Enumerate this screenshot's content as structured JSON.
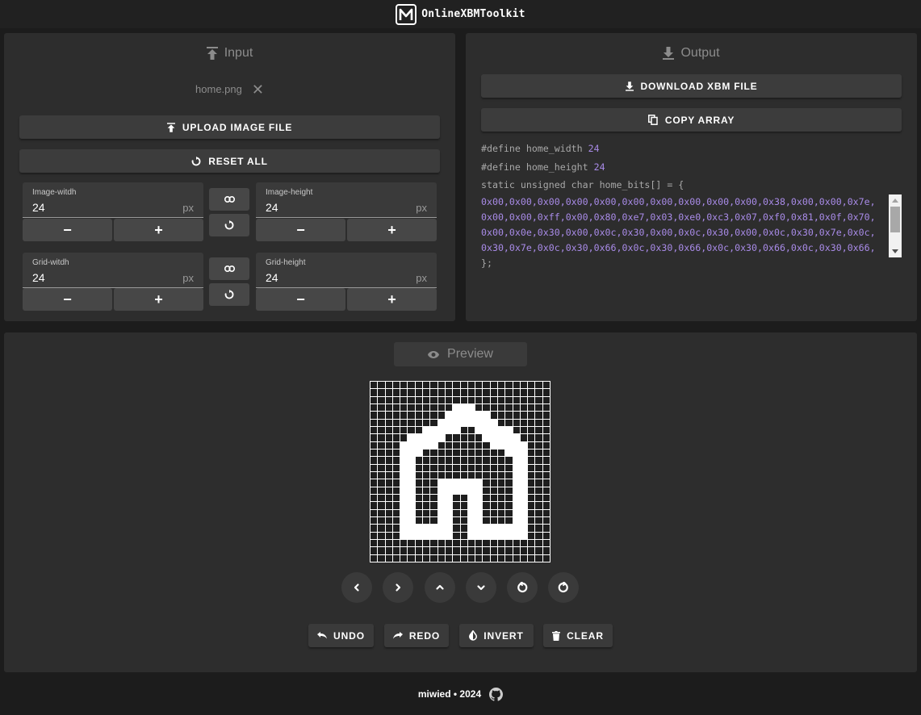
{
  "header": {
    "title": "OnlineXBMToolkit",
    "logo_icon": "logo-m-icon"
  },
  "input": {
    "title": "Input",
    "filename": "home.png",
    "upload_label": "UPLOAD IMAGE FILE",
    "reset_label": "RESET ALL",
    "image_width": {
      "label": "Image-witdh",
      "value": "24",
      "unit": "px"
    },
    "image_height": {
      "label": "Image-height",
      "value": "24",
      "unit": "px"
    },
    "grid_width": {
      "label": "Grid-witdh",
      "value": "24",
      "unit": "px"
    },
    "grid_height": {
      "label": "Grid-height",
      "value": "24",
      "unit": "px"
    },
    "minus": "−",
    "plus": "+"
  },
  "output": {
    "title": "Output",
    "download_label": "DOWNLOAD XBM FILE",
    "copy_label": "COPY ARRAY",
    "define_width": "#define home_width ",
    "width_value": "24",
    "define_height": "#define home_height ",
    "height_value": "24",
    "array_decl": "static unsigned char home_bits[] = {",
    "array_lines": [
      "0x00,0x00,0x00,0x00,0x00,0x00,0x00,0x00,0x00,0x00,0x38,0x00,0x00,0x7e,",
      "0x00,0x00,0xff,0x00,0x80,0xe7,0x03,0xe0,0xc3,0x07,0xf0,0x81,0x0f,0x70,",
      "0x00,0x0e,0x30,0x00,0x0c,0x30,0x00,0x0c,0x30,0x00,0x0c,0x30,0x7e,0x0c,",
      "0x30,0x7e,0x0c,0x30,0x66,0x0c,0x30,0x66,0x0c,0x30,0x66,0x0c,0x30,0x66,"
    ],
    "array_close": "};"
  },
  "preview": {
    "title": "Preview",
    "rows": [
      "000000000000000000000000",
      "000000000000000000000000",
      "000000000000000000000000",
      "000000000001110000000000",
      "000000000011111100000000",
      "000000000111111110000000",
      "000000011111001111100000",
      "000001111100000111110000",
      "000011111000000011111000",
      "000011100000000000111000",
      "000011000000000000011000",
      "000011000000000000011000",
      "000011000000000000011000",
      "000011000111111000011000",
      "000011000111111000011000",
      "000011000110011000011000",
      "000011000110011000011000",
      "000011000110011000011000",
      "000011000110011000011000",
      "000011111110011111111000",
      "000011111110011111111000",
      "000000000000000000000000",
      "000000000000000000000000",
      "000000000000000000000000"
    ],
    "undo_label": "UNDO",
    "redo_label": "REDO",
    "invert_label": "INVERT",
    "clear_label": "CLEAR"
  },
  "footer": {
    "text": "miwied • 2024",
    "icon": "github-icon"
  }
}
